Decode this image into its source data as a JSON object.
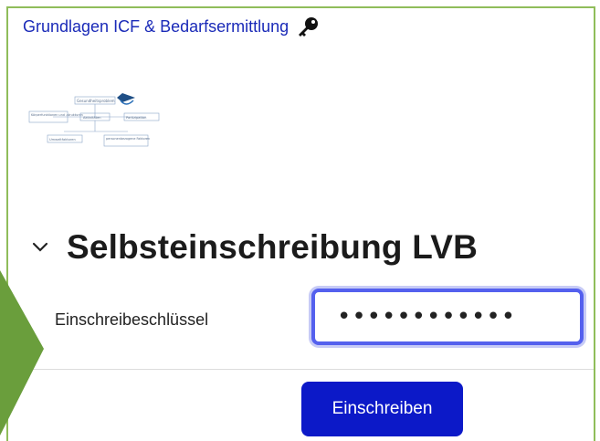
{
  "course": {
    "title": "Grundlagen ICF & Bedarfsermittlung",
    "icon": "key-icon"
  },
  "thumbnail": {
    "alt": "ICF model diagram",
    "labels": [
      "Gesundheitsproblem",
      "Körperfunktionen und -strukturen",
      "Aktivitäten",
      "Partizipation",
      "Umweltfaktoren",
      "personenbezogene Faktoren"
    ]
  },
  "section": {
    "title": "Selbsteinschreibung LVB",
    "toggle_icon": "chevron-down-icon"
  },
  "form": {
    "key_label": "Einschreibeschlüssel",
    "key_value": "••••••••••••",
    "submit_label": "Einschreiben"
  },
  "colors": {
    "frame_border": "#8fbd5a",
    "link": "#1a2ab8",
    "input_focus": "#5460ee",
    "button": "#0c19c8",
    "pointer_arrow": "#6a9e3c"
  }
}
